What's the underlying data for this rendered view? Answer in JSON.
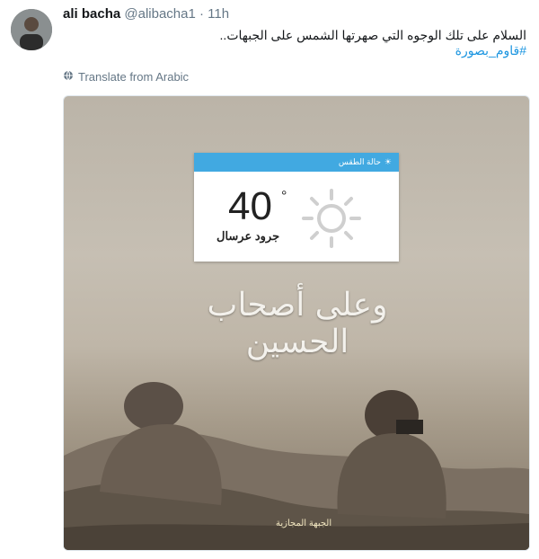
{
  "tweet": {
    "name": "ali bacha",
    "handle": "@alibacha1",
    "separator": "·",
    "time": "11h",
    "text": "السلام على تلك الوجوه التي صهرتها الشمس على الجبهات..",
    "hashtag": "#قاوم_بصورة",
    "translate_label": "Translate from Arabic"
  },
  "media": {
    "widget_title": "حالة الطقس",
    "temperature": "40",
    "degree_symbol": "°",
    "location": "جرود عرسال",
    "calligraphy": "وعلى أصحاب الحسين",
    "logo_text": "الجبهة المجازية"
  },
  "colors": {
    "link": "#1b95e0",
    "widget_accent": "#41a9e1"
  }
}
